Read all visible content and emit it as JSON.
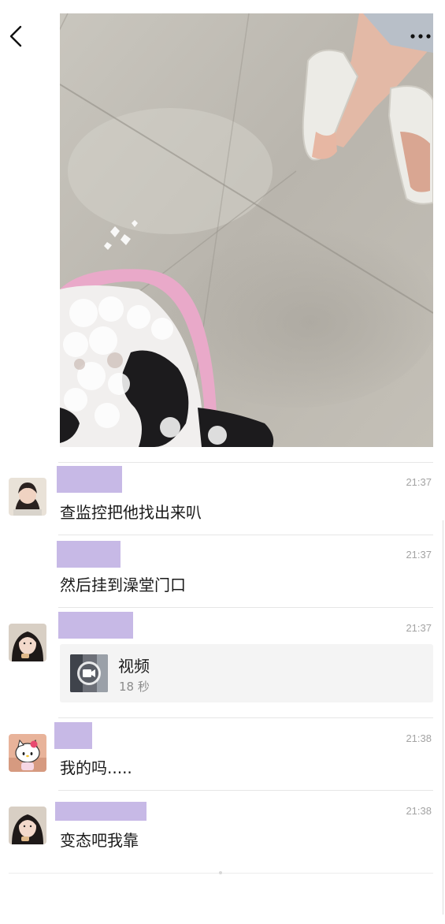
{
  "header": {
    "back_icon": "chevron-left-icon",
    "more_icon": "more-dots-icon"
  },
  "photo": {
    "description_icon": "photo-image"
  },
  "messages": [
    {
      "time": "21:37",
      "text": "查监控把他找出来叭"
    },
    {
      "time": "21:37",
      "text": "然后挂到澡堂门口"
    },
    {
      "time": "21:37",
      "video": {
        "title": "视频",
        "duration": "18 秒"
      }
    },
    {
      "time": "21:38",
      "text": "我的吗....."
    },
    {
      "time": "21:38",
      "text": "变态吧我靠"
    }
  ],
  "colors": {
    "name_redaction": "#c7b9e6",
    "time": "#a3a3a3"
  }
}
